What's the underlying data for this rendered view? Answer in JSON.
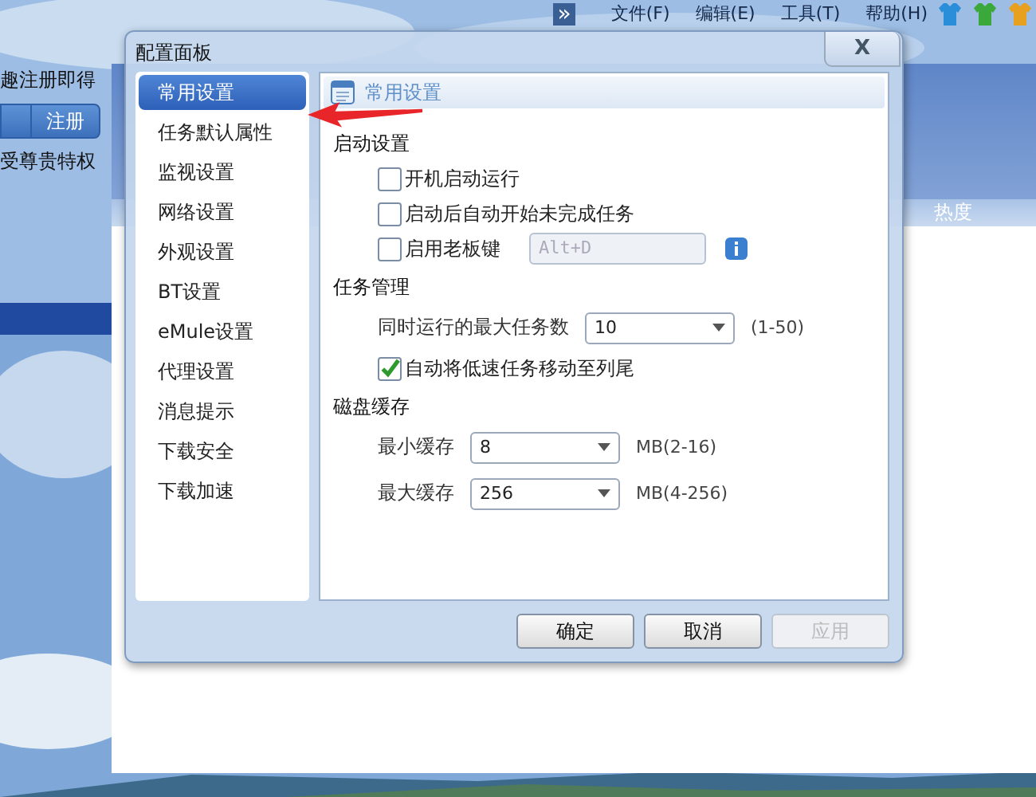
{
  "menu_bar": {
    "overflow": "»",
    "items": [
      "文件(F)",
      "编辑(E)",
      "工具(T)",
      "帮助(H)"
    ],
    "icons": [
      {
        "color": "#2a8fd8"
      },
      {
        "color": "#3aa83a"
      },
      {
        "color": "#e8a020"
      }
    ]
  },
  "left_panel": {
    "promo_text": "趣注册即得",
    "register_button": "注册",
    "privilege_text": "受尊贵特权"
  },
  "task_list": {
    "columns": [
      "热度"
    ]
  },
  "dialog": {
    "title": "配置面板",
    "close": "X",
    "sidebar": {
      "items": [
        {
          "label": "常用设置",
          "selected": true
        },
        {
          "label": "任务默认属性",
          "selected": false
        },
        {
          "label": "监视设置",
          "selected": false
        },
        {
          "label": "网络设置",
          "selected": false
        },
        {
          "label": "外观设置",
          "selected": false
        },
        {
          "label": "BT设置",
          "selected": false
        },
        {
          "label": "eMule设置",
          "selected": false
        },
        {
          "label": "代理设置",
          "selected": false
        },
        {
          "label": "消息提示",
          "selected": false
        },
        {
          "label": "下载安全",
          "selected": false
        },
        {
          "label": "下载加速",
          "selected": false
        }
      ]
    },
    "panel_title": "常用设置",
    "sections": [
      {
        "title": "启动设置",
        "rows": [
          {
            "kind": "checkbox",
            "label": "开机启动运行",
            "checked": false
          },
          {
            "kind": "checkbox",
            "label": "启动后自动开始未完成任务",
            "checked": false
          },
          {
            "kind": "checkbox_field",
            "label": "启用老板键",
            "checked": false,
            "value": "Alt+D",
            "disabled": true
          }
        ]
      },
      {
        "title": "任务管理",
        "rows": [
          {
            "kind": "select",
            "label": "同时运行的最大任务数",
            "value": "10",
            "hint": "(1-50)"
          },
          {
            "kind": "checkbox",
            "label": "自动将低速任务移动至列尾",
            "checked": true
          }
        ]
      },
      {
        "title": "磁盘缓存",
        "rows": [
          {
            "kind": "select",
            "label": "最小缓存",
            "value": "8",
            "hint": "MB(2-16)"
          },
          {
            "kind": "select",
            "label": "最大缓存",
            "value": "256",
            "hint": "MB(4-256)"
          }
        ]
      }
    ],
    "buttons": [
      {
        "label": "确定",
        "disabled": false
      },
      {
        "label": "取消",
        "disabled": false
      },
      {
        "label": "应用",
        "disabled": true
      }
    ]
  }
}
